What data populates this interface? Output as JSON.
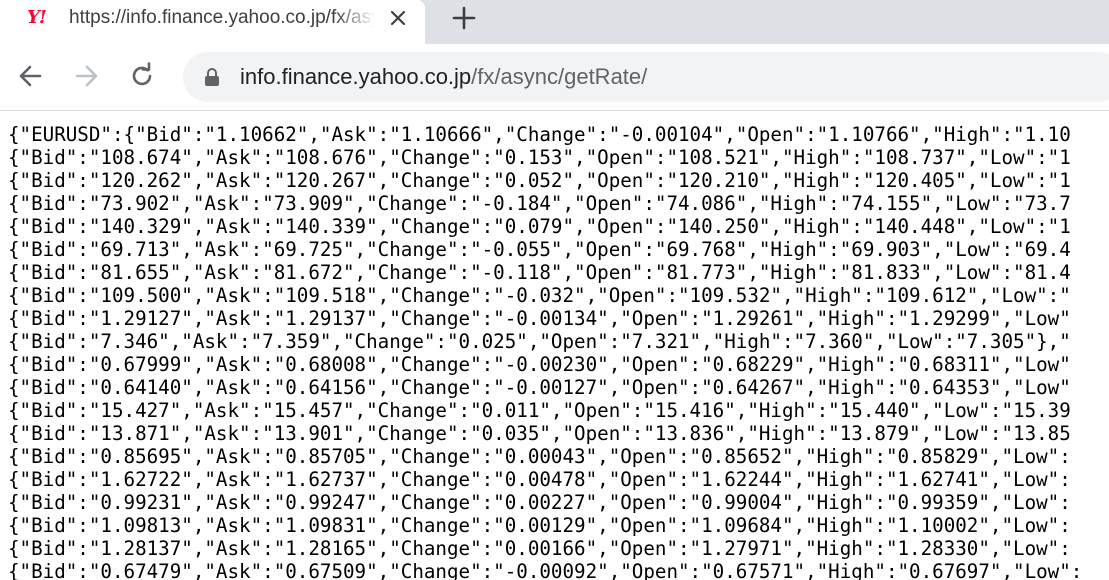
{
  "browser": {
    "tab": {
      "title": "https://info.finance.yahoo.co.jp/fx/async/getRate/",
      "favicon": "Y!",
      "favicon_color": "#ff0033"
    },
    "address_bar": {
      "host": "info.finance.yahoo.co.jp",
      "path": "/fx/async/getRate/"
    },
    "icons": {
      "close": "close-icon",
      "new_tab": "plus-icon",
      "back": "back-arrow-icon",
      "forward": "forward-arrow-icon",
      "reload": "reload-icon",
      "lock": "lock-icon"
    }
  },
  "page": {
    "lines": [
      "{\"EURUSD\":{\"Bid\":\"1.10662\",\"Ask\":\"1.10666\",\"Change\":\"-0.00104\",\"Open\":\"1.10766\",\"High\":\"1.10",
      "{\"Bid\":\"108.674\",\"Ask\":\"108.676\",\"Change\":\"0.153\",\"Open\":\"108.521\",\"High\":\"108.737\",\"Low\":\"1",
      "{\"Bid\":\"120.262\",\"Ask\":\"120.267\",\"Change\":\"0.052\",\"Open\":\"120.210\",\"High\":\"120.405\",\"Low\":\"1",
      "{\"Bid\":\"73.902\",\"Ask\":\"73.909\",\"Change\":\"-0.184\",\"Open\":\"74.086\",\"High\":\"74.155\",\"Low\":\"73.7",
      "{\"Bid\":\"140.329\",\"Ask\":\"140.339\",\"Change\":\"0.079\",\"Open\":\"140.250\",\"High\":\"140.448\",\"Low\":\"1",
      "{\"Bid\":\"69.713\",\"Ask\":\"69.725\",\"Change\":\"-0.055\",\"Open\":\"69.768\",\"High\":\"69.903\",\"Low\":\"69.4",
      "{\"Bid\":\"81.655\",\"Ask\":\"81.672\",\"Change\":\"-0.118\",\"Open\":\"81.773\",\"High\":\"81.833\",\"Low\":\"81.4",
      "{\"Bid\":\"109.500\",\"Ask\":\"109.518\",\"Change\":\"-0.032\",\"Open\":\"109.532\",\"High\":\"109.612\",\"Low\":\"",
      "{\"Bid\":\"1.29127\",\"Ask\":\"1.29137\",\"Change\":\"-0.00134\",\"Open\":\"1.29261\",\"High\":\"1.29299\",\"Low\"",
      "{\"Bid\":\"7.346\",\"Ask\":\"7.359\",\"Change\":\"0.025\",\"Open\":\"7.321\",\"High\":\"7.360\",\"Low\":\"7.305\"},\"",
      "{\"Bid\":\"0.67999\",\"Ask\":\"0.68008\",\"Change\":\"-0.00230\",\"Open\":\"0.68229\",\"High\":\"0.68311\",\"Low\"",
      "{\"Bid\":\"0.64140\",\"Ask\":\"0.64156\",\"Change\":\"-0.00127\",\"Open\":\"0.64267\",\"High\":\"0.64353\",\"Low\"",
      "{\"Bid\":\"15.427\",\"Ask\":\"15.457\",\"Change\":\"0.011\",\"Open\":\"15.416\",\"High\":\"15.440\",\"Low\":\"15.39",
      "{\"Bid\":\"13.871\",\"Ask\":\"13.901\",\"Change\":\"0.035\",\"Open\":\"13.836\",\"High\":\"13.879\",\"Low\":\"13.85",
      "{\"Bid\":\"0.85695\",\"Ask\":\"0.85705\",\"Change\":\"0.00043\",\"Open\":\"0.85652\",\"High\":\"0.85829\",\"Low\":",
      "{\"Bid\":\"1.62722\",\"Ask\":\"1.62737\",\"Change\":\"0.00478\",\"Open\":\"1.62244\",\"High\":\"1.62741\",\"Low\":",
      "{\"Bid\":\"0.99231\",\"Ask\":\"0.99247\",\"Change\":\"0.00227\",\"Open\":\"0.99004\",\"High\":\"0.99359\",\"Low\":",
      "{\"Bid\":\"1.09813\",\"Ask\":\"1.09831\",\"Change\":\"0.00129\",\"Open\":\"1.09684\",\"High\":\"1.10002\",\"Low\":",
      "{\"Bid\":\"1.28137\",\"Ask\":\"1.28165\",\"Change\":\"0.00166\",\"Open\":\"1.27971\",\"High\":\"1.28330\",\"Low\":",
      "{\"Bid\":\"0.67479\",\"Ask\":\"0.67509\",\"Change\":\"-0.00092\",\"Open\":\"0.67571\",\"High\":\"0.67697\",\"Low\":"
    ]
  }
}
